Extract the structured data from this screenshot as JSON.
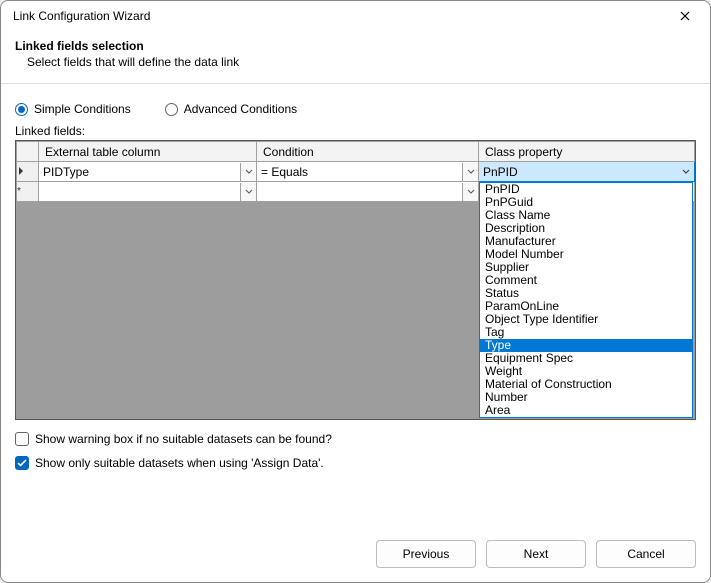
{
  "title": "Link Configuration Wizard",
  "step_title": "Linked fields selection",
  "step_desc": "Select fields that will define the data link",
  "radios": {
    "simple": "Simple Conditions",
    "advanced": "Advanced Conditions",
    "selected": "simple"
  },
  "linked_fields_label": "Linked fields:",
  "columns": {
    "external": "External table column",
    "condition": "Condition",
    "class": "Class property"
  },
  "rows": [
    {
      "external": "PIDType",
      "condition": "= Equals",
      "class": "PnPID"
    }
  ],
  "class_property_options": [
    "PnPID",
    "PnPGuid",
    "Class Name",
    "Description",
    "Manufacturer",
    "Model Number",
    "Supplier",
    "Comment",
    "Status",
    "ParamOnLine",
    "Object Type Identifier",
    "Tag",
    "Type",
    "Equipment Spec",
    "Weight",
    "Material of Construction",
    "Number",
    "Area"
  ],
  "class_property_highlighted": "Type",
  "check_warn": "Show warning box if no suitable datasets can be found?",
  "check_suitable": "Show only suitable datasets when using 'Assign Data'.",
  "check_warn_checked": false,
  "check_suitable_checked": true,
  "buttons": {
    "previous": "Previous",
    "next": "Next",
    "cancel": "Cancel"
  }
}
